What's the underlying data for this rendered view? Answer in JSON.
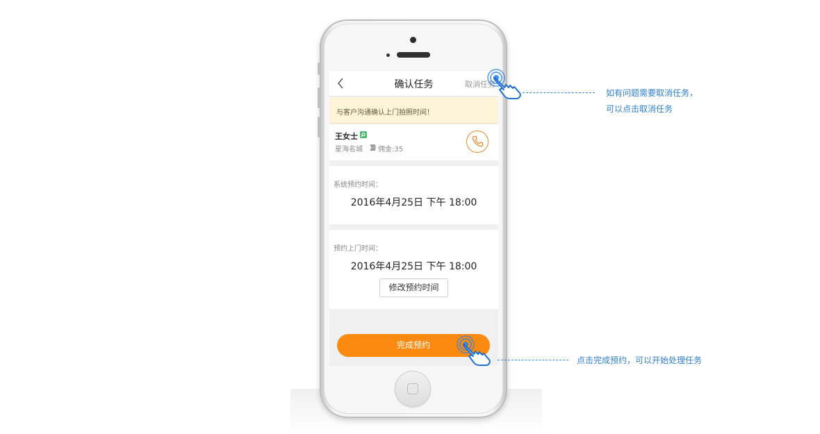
{
  "nav": {
    "title": "确认任务",
    "cancel_label": "取消任务"
  },
  "notice": {
    "text": "与客户沟通确认上门拍照时间！"
  },
  "customer": {
    "name": "王女士",
    "address": "星海名城",
    "commission": "佣金:35"
  },
  "system_time": {
    "label": "系统预约时间：",
    "value": "2016年4月25日 下午 18:00"
  },
  "visit_time": {
    "label": "预约上门时间：",
    "value": "2016年4月25日 下午 18:00",
    "modify_label": "修改预约时间"
  },
  "actions": {
    "complete_label": "完成预约"
  },
  "annotations": {
    "cancel_line1": "如有问题需要取消任务，",
    "cancel_line2": "可以点击取消任务",
    "complete": "点击完成预约，可以开始处理任务"
  },
  "colors": {
    "accent": "#fb8a10",
    "note_blue": "#2e7fd0",
    "notice_bg": "#fdf4d9"
  },
  "icons": [
    "back-arrow-icon",
    "tag-icon",
    "coin-icon",
    "phone-icon",
    "hand-pointer-icon"
  ]
}
